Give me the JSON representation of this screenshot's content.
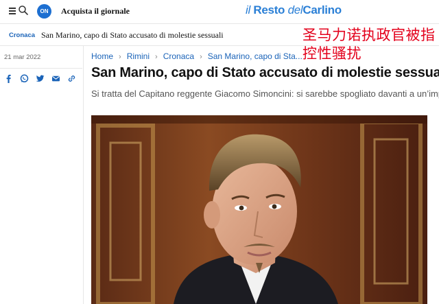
{
  "header": {
    "on_badge": "ON",
    "subscribe_label": "Acquista il giornale",
    "logo": {
      "part1": "il",
      "part2": "Resto",
      "part3": "del",
      "part4": "Carlino"
    }
  },
  "subbar": {
    "section": "Cronaca",
    "title": "San Marino, capo di Stato accusato di molestie sessuali"
  },
  "overlay": {
    "text": "圣马力诺执政官被指控性骚扰"
  },
  "article": {
    "date": "21 mar 2022",
    "breadcrumbs": [
      "Home",
      "Rimini",
      "Cronaca",
      "San Marino, capo di Sta..."
    ],
    "headline": "San Marino, capo di Stato accusato di molestie sessuali",
    "subhead": "Si tratta del Capitano reggente Giacomo Simoncini: si sarebbe spogliato davanti a un’impiegata"
  },
  "share_icons": [
    "facebook-icon",
    "whatsapp-icon",
    "twitter-icon",
    "email-icon",
    "link-icon"
  ],
  "colors": {
    "accent": "#1a63b8",
    "logo": "#2a7fd6",
    "overlay": "#e3001b",
    "on_badge": "#1d6fd1"
  }
}
